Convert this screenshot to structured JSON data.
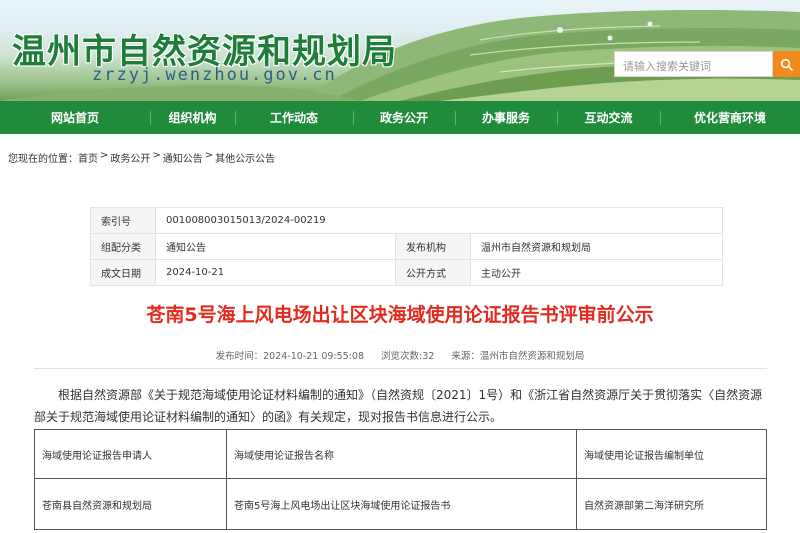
{
  "header": {
    "site_title": "温州市自然资源和规划局",
    "domain": "zrzyj.wenzhou.gov.cn",
    "search_placeholder": "请输入搜索关键词"
  },
  "nav": {
    "items": [
      "网站首页",
      "组织机构",
      "工作动态",
      "政务公开",
      "办事服务",
      "互动交流",
      "优化营商环境"
    ]
  },
  "breadcrumb": {
    "prefix": "您现在的位置：",
    "items": [
      "首页",
      "政务公开",
      "通知公告",
      "其他公示公告"
    ],
    "separator": ">"
  },
  "info": {
    "index_label": "索引号",
    "index_value": "001008003015013/2024-00219",
    "category_label": "组配分类",
    "category_value": "通知公告",
    "publisher_label": "发布机构",
    "publisher_value": "温州市自然资源和规划局",
    "date_label": "成文日期",
    "date_value": "2024-10-21",
    "method_label": "公开方式",
    "method_value": "主动公开"
  },
  "article": {
    "title": "苍南5号海上风电场出让区块海域使用论证报告书评审前公示",
    "published": "发布时间：2024-10-21 09:55:08",
    "views": "浏览次数:32",
    "source": "来源：温州市自然资源和规划局",
    "paragraph": "根据自然资源部《关于规范海域使用论证材料编制的通知》（自然资规〔2021〕1号）和《浙江省自然资源厅关于贯彻落实〈自然资源部关于规范海域使用论证材料编制的通知〉的函》有关规定，现对报告书信息进行公示。"
  },
  "table": {
    "headers": [
      "海域使用论证报告申请人",
      "海域使用论证报告名称",
      "海域使用论证报告编制单位"
    ],
    "rows": [
      [
        "苍南县自然资源和规划局",
        "苍南5号海上风电场出让区块海域使用论证报告书",
        "自然资源部第二海洋研究所"
      ]
    ]
  },
  "colors": {
    "brand_green": "#218b3c",
    "title_red": "#e02c1f",
    "search_orange": "#f08a1c"
  }
}
